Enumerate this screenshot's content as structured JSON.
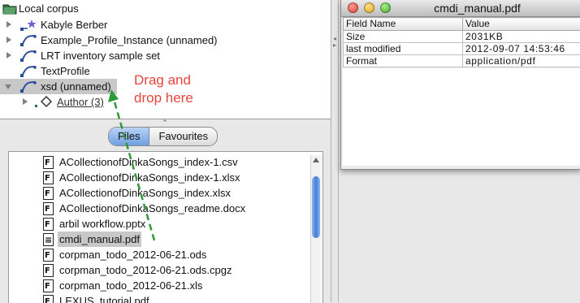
{
  "tree": {
    "root_label": "Local corpus",
    "nodes": [
      {
        "label": "Kabyle Berber"
      },
      {
        "label": "Example_Profile_Instance (unnamed)"
      },
      {
        "label": "LRT inventory sample set"
      },
      {
        "label": "TextProfile"
      },
      {
        "label": "xsd (unnamed)"
      },
      {
        "label": "Author (3)"
      }
    ]
  },
  "tabs": [
    {
      "label": "Files",
      "active": true
    },
    {
      "label": "Favourites",
      "active": false
    }
  ],
  "files": [
    {
      "name": "ACollectionofDinkaSongs_index-1.csv"
    },
    {
      "name": "ACollectionofDinkaSongs_index-1.xlsx"
    },
    {
      "name": "ACollectionofDinkaSongs_index.xlsx"
    },
    {
      "name": "ACollectionofDinkaSongs_readme.docx"
    },
    {
      "name": "arbil workflow.pptx"
    },
    {
      "name": "cmdi_manual.pdf",
      "selected": true
    },
    {
      "name": "corpman_todo_2012-06-21.ods"
    },
    {
      "name": "corpman_todo_2012-06-21.ods.cpgz"
    },
    {
      "name": "corpman_todo_2012-06-21.xls"
    },
    {
      "name": "LEXUS_tutorial.pdf"
    }
  ],
  "meta_window": {
    "title": "cmdi_manual.pdf",
    "columns": [
      "Field Name",
      "Value"
    ],
    "rows": [
      {
        "field": "Size",
        "value": "2031KB"
      },
      {
        "field": "last modified",
        "value": "2012-09-07 14:53:46"
      },
      {
        "field": "Format",
        "value": "application/pdf"
      }
    ]
  },
  "annotation": {
    "line1": "Drag and",
    "line2": "drop here",
    "color": "#e8463c",
    "arrow_color": "#2e9a3a"
  },
  "icons": {
    "root": "folder-icon",
    "node": "cmdi-node-icon",
    "author": "diamond-icon",
    "file": "file-icon"
  }
}
